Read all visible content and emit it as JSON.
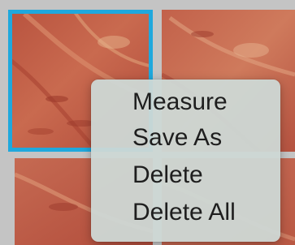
{
  "context_menu": {
    "items": [
      {
        "label": "Measure"
      },
      {
        "label": "Save As"
      },
      {
        "label": "Delete"
      },
      {
        "label": "Delete All"
      }
    ]
  },
  "thumbnails": {
    "selected_index": 0,
    "selection_color": "#1fa8dd"
  }
}
